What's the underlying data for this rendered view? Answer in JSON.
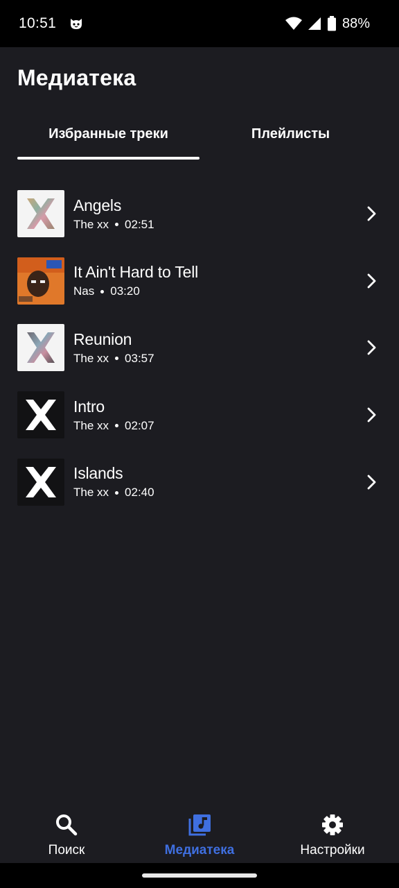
{
  "status_bar": {
    "time": "10:51",
    "notification_icon": "cat-face-icon",
    "battery_percent": "88%",
    "icons": [
      "wifi-icon",
      "cellular-signal-icon",
      "battery-icon"
    ]
  },
  "page": {
    "title": "Медиатека"
  },
  "tabs": [
    {
      "label": "Избранные треки",
      "active": true
    },
    {
      "label": "Плейлисты",
      "active": false
    }
  ],
  "tracks": [
    {
      "title": "Angels",
      "artist": "The xx",
      "duration": "02:51",
      "cover": "the-xx-coexist"
    },
    {
      "title": "It Ain't Hard to Tell",
      "artist": "Nas",
      "duration": "03:20",
      "cover": "nas-illmatic"
    },
    {
      "title": "Reunion",
      "artist": "The xx",
      "duration": "03:57",
      "cover": "the-xx-coexist"
    },
    {
      "title": "Intro",
      "artist": "The xx",
      "duration": "02:07",
      "cover": "the-xx-xx"
    },
    {
      "title": "Islands",
      "artist": "The xx",
      "duration": "02:40",
      "cover": "the-xx-xx"
    }
  ],
  "bottom_nav": [
    {
      "label": "Поиск",
      "icon": "search-icon",
      "active": false
    },
    {
      "label": "Медиатека",
      "icon": "library-music-icon",
      "active": true
    },
    {
      "label": "Настройки",
      "icon": "gear-icon",
      "active": false
    }
  ],
  "colors": {
    "background": "#1c1c21",
    "status_bar": "#000000",
    "accent": "#3f6fe0",
    "text": "#ffffff"
  }
}
